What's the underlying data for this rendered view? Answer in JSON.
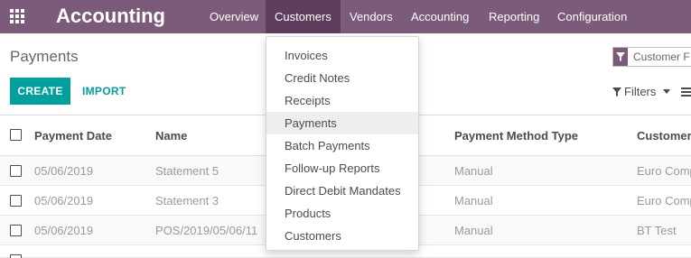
{
  "navbar": {
    "app_title": "Accounting",
    "menu": [
      "Overview",
      "Customers",
      "Vendors",
      "Accounting",
      "Reporting",
      "Configuration"
    ],
    "active_menu": "Customers",
    "color": "#7c5b7a"
  },
  "control_panel": {
    "title": "Payments",
    "create_label": "CREATE",
    "import_label": "IMPORT",
    "search_facet": "Customer F",
    "filters_label": "Filters",
    "accent": "#00a09d"
  },
  "table": {
    "columns": [
      "Payment Date",
      "Name",
      "Payment Method Type",
      "Customer"
    ],
    "rows": [
      {
        "date": "05/06/2019",
        "name": "Statement 5",
        "method": "Manual",
        "customer": "Euro Comp"
      },
      {
        "date": "05/06/2019",
        "name": "Statement 3",
        "method": "Manual",
        "customer": "Euro Comp"
      },
      {
        "date": "05/06/2019",
        "name": "POS/2019/05/06/11",
        "method": "Manual",
        "customer": "BT Test"
      }
    ]
  },
  "customers_dropdown": {
    "items": [
      "Invoices",
      "Credit Notes",
      "Receipts",
      "Payments",
      "Batch Payments",
      "Follow-up Reports",
      "Direct Debit Mandates",
      "Products",
      "Customers"
    ],
    "active_item": "Payments"
  }
}
